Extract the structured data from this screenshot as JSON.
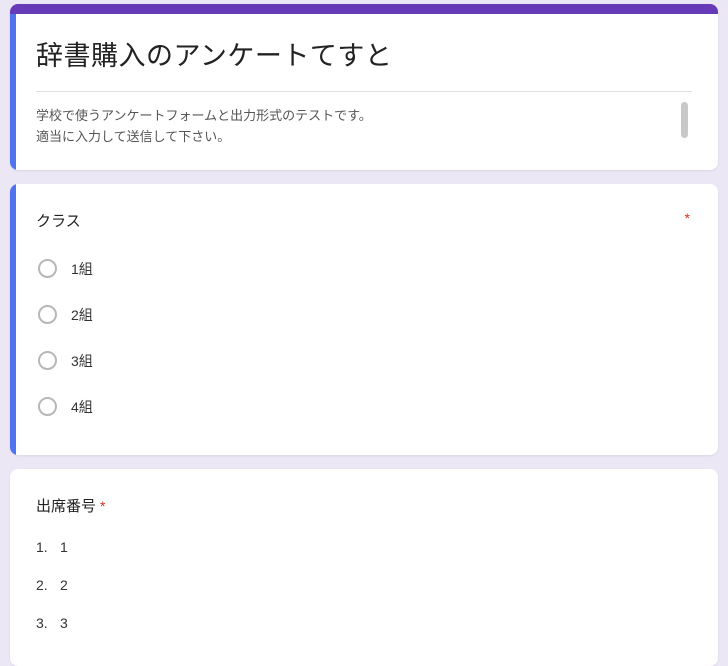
{
  "header": {
    "title": "辞書購入のアンケートてすと",
    "description": "学校で使うアンケートフォームと出力形式のテストです。\n適当に入力して送信して下さい。"
  },
  "questions": [
    {
      "title": "クラス",
      "required": true,
      "required_position": "right",
      "type": "radio",
      "options": [
        "1組",
        "2組",
        "3組",
        "4組"
      ]
    },
    {
      "title": "出席番号",
      "required": true,
      "required_position": "inline",
      "type": "ordered",
      "items": [
        {
          "num": "1.",
          "val": "1"
        },
        {
          "num": "2.",
          "val": "2"
        },
        {
          "num": "3.",
          "val": "3"
        }
      ]
    }
  ],
  "required_mark": "*"
}
